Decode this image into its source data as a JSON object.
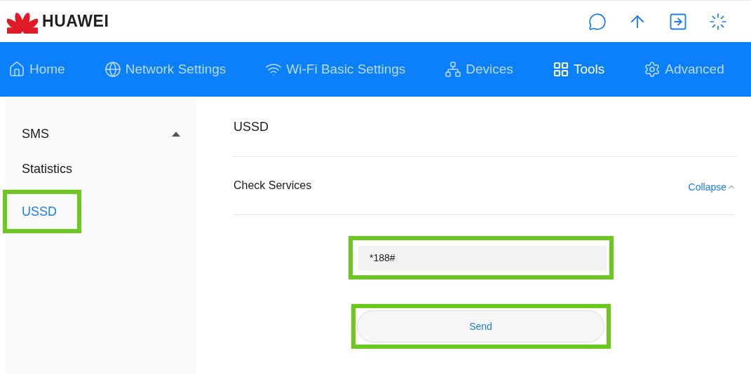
{
  "brand": {
    "name": "HUAWEI"
  },
  "nav": [
    {
      "label": "Home",
      "selected": false
    },
    {
      "label": "Network Settings",
      "selected": false
    },
    {
      "label": "Wi-Fi Basic Settings",
      "selected": false
    },
    {
      "label": "Devices",
      "selected": false
    },
    {
      "label": "Tools",
      "selected": true
    },
    {
      "label": "Advanced",
      "selected": false
    }
  ],
  "sidebar": {
    "items": [
      {
        "label": "SMS",
        "kind": "group",
        "expanded": true,
        "selected": false,
        "highlighted": false
      },
      {
        "label": "Statistics",
        "kind": "link",
        "selected": false,
        "highlighted": false
      },
      {
        "label": "USSD",
        "kind": "link",
        "selected": true,
        "highlighted": true
      }
    ]
  },
  "content": {
    "title": "USSD",
    "section": {
      "title": "Check Services",
      "toggle": "Collapse"
    },
    "input": {
      "value": "*188#",
      "highlighted": true
    },
    "send_button": {
      "label": "Send",
      "highlighted": true
    }
  }
}
